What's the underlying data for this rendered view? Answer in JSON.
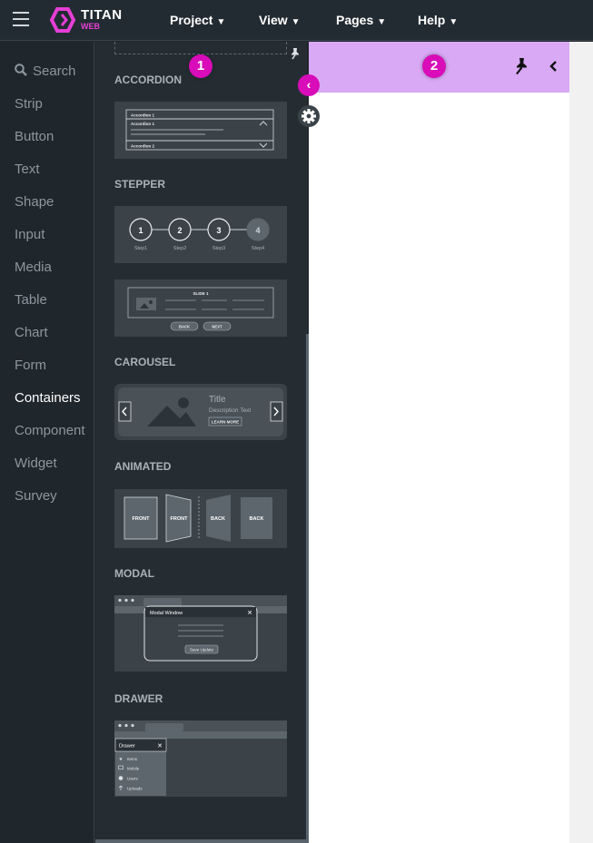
{
  "app": {
    "logo_text": "TITAN",
    "logo_sub": "WEB"
  },
  "menu": [
    {
      "label": "Project"
    },
    {
      "label": "View"
    },
    {
      "label": "Pages"
    },
    {
      "label": "Help"
    }
  ],
  "sidebar": {
    "search_label": "Search",
    "items": [
      {
        "label": "Strip"
      },
      {
        "label": "Button"
      },
      {
        "label": "Text"
      },
      {
        "label": "Shape"
      },
      {
        "label": "Input"
      },
      {
        "label": "Media"
      },
      {
        "label": "Table"
      },
      {
        "label": "Chart"
      },
      {
        "label": "Form"
      },
      {
        "label": "Containers"
      },
      {
        "label": "Component"
      },
      {
        "label": "Widget"
      },
      {
        "label": "Survey"
      }
    ],
    "active": "Containers"
  },
  "panel": {
    "sections": {
      "accordion": "ACCORDION",
      "stepper": "STEPPER",
      "carousel": "CAROUSEL",
      "animated": "ANIMATED",
      "modal": "MODAL",
      "drawer": "DRAWER"
    },
    "accordion_thumb": {
      "row1": "Accordion 1",
      "row2": "Accordion 1",
      "row3": "Accordion 2"
    },
    "stepper_thumb": {
      "steps": [
        "1",
        "2",
        "3",
        "4"
      ],
      "labels": [
        "Step1",
        "Step2",
        "Step3",
        "Step4"
      ]
    },
    "stepper_slide": {
      "title": "SLIDE 1",
      "back": "BACK",
      "next": "NEXT"
    },
    "carousel_thumb": {
      "title": "Title",
      "desc": "Description Text",
      "button": "LEARN MORE"
    },
    "animated_thumb": {
      "front1": "FRONT",
      "front2": "FRONT",
      "back1": "BACK",
      "back2": "BACK"
    },
    "modal_thumb": {
      "title": "Modal Window",
      "button": "Save Update"
    },
    "drawer_thumb": {
      "title": "Drawer",
      "items": [
        "Items",
        "Mobile",
        "Users",
        "Uploads"
      ]
    }
  },
  "badges": {
    "one": "1",
    "two": "2"
  },
  "colors": {
    "accent": "#d80cb8",
    "canvas_header": "#d9a9f5",
    "topbar": "#232b32"
  }
}
